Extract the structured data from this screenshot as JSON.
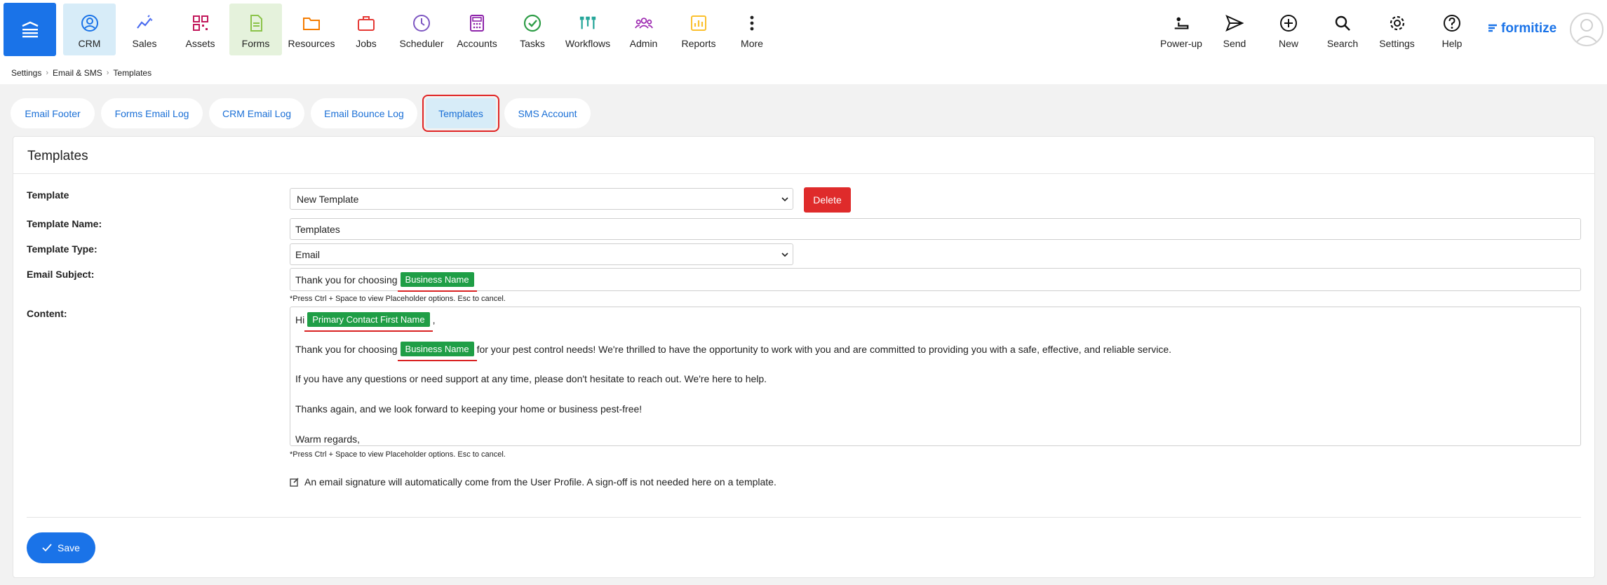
{
  "nav": {
    "items": [
      {
        "label": "CRM",
        "icon": "crm-icon"
      },
      {
        "label": "Sales",
        "icon": "sales-icon"
      },
      {
        "label": "Assets",
        "icon": "assets-icon"
      },
      {
        "label": "Forms",
        "icon": "forms-icon"
      },
      {
        "label": "Resources",
        "icon": "resources-icon"
      },
      {
        "label": "Jobs",
        "icon": "jobs-icon"
      },
      {
        "label": "Scheduler",
        "icon": "scheduler-icon"
      },
      {
        "label": "Accounts",
        "icon": "accounts-icon"
      },
      {
        "label": "Tasks",
        "icon": "tasks-icon"
      },
      {
        "label": "Workflows",
        "icon": "workflows-icon"
      },
      {
        "label": "Admin",
        "icon": "admin-icon"
      },
      {
        "label": "Reports",
        "icon": "reports-icon"
      },
      {
        "label": "More",
        "icon": "more-icon"
      }
    ],
    "right_items": [
      {
        "label": "Power-up",
        "icon": "power-up-icon"
      },
      {
        "label": "Send",
        "icon": "send-icon"
      },
      {
        "label": "New",
        "icon": "new-icon"
      },
      {
        "label": "Search",
        "icon": "search-icon"
      },
      {
        "label": "Settings",
        "icon": "gear-icon"
      },
      {
        "label": "Help",
        "icon": "help-icon"
      }
    ],
    "logo_text": "formitize",
    "colors": {
      "accent": "#1a73e8",
      "crm": "#1a73e8",
      "sales": "#4b6cf0",
      "assets": "#c2185b",
      "forms": "#8bc34a",
      "resources": "#f57c00",
      "jobs": "#e53935",
      "scheduler": "#7e57c2",
      "accounts": "#8e24aa",
      "tasks": "#2e9d47",
      "workflows": "#26a69a",
      "admin": "#9c27b0",
      "reports": "#fbc02d"
    }
  },
  "breadcrumb": [
    "Settings",
    "Email & SMS",
    "Templates"
  ],
  "tabs": [
    "Email Footer",
    "Forms Email Log",
    "CRM Email Log",
    "Email Bounce Log",
    "Templates",
    "SMS Account"
  ],
  "panel": {
    "title": "Templates",
    "template_label": "Template",
    "template_value": "New Template",
    "delete_label": "Delete",
    "name_label": "Template Name:",
    "name_value": "Templates",
    "type_label": "Template Type:",
    "type_value": "Email",
    "subject_label": "Email Subject:",
    "subject_prefix": "Thank you for choosing",
    "subject_chip": "Business Name",
    "hint": "*Press Ctrl + Space to view Placeholder options. Esc to cancel.",
    "content_label": "Content:",
    "content": {
      "line1_prefix": "Hi",
      "line1_chip": "Primary Contact First Name",
      "line1_suffix": ",",
      "line2_prefix": "Thank you for choosing",
      "line2_chip": "Business Name",
      "line2_suffix": "for your pest control needs! We're thrilled to have the opportunity to work with you and are committed to providing you with a safe, effective, and reliable service.",
      "line3": "If you have any questions or need support at any time, please don't hesitate to reach out. We're here to help.",
      "line4": "Thanks again, and we look forward to keeping your home or business pest-free!",
      "line5": "Warm regards,"
    },
    "signature_note": "An email signature will automatically come from the User Profile. A sign-off is not needed here on a template.",
    "save_label": "Save"
  }
}
